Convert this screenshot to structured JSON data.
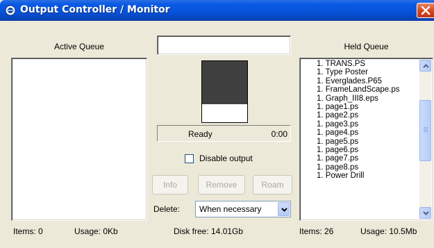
{
  "window": {
    "title": "Output Controller / Monitor"
  },
  "active_queue": {
    "header": "Active Queue",
    "items": [],
    "footer_items": "Items: 0",
    "footer_usage": "Usage: 0Kb"
  },
  "held_queue": {
    "header": "Held Queue",
    "items": [
      "1. TRANS.PS",
      "1. Type Poster",
      "1. Everglades.P65",
      "1. FrameLandScape.ps",
      "1. Graph_III8.eps",
      "1. page1.ps",
      "1. page2.ps",
      "1. page3.ps",
      "1. page4.ps",
      "1. page5.ps",
      "1. page6.ps",
      "1. page7.ps",
      "1. page8.ps",
      "1. Power Drill"
    ],
    "footer_items": "Items:  26",
    "footer_usage": "Usage: 10.5Mb"
  },
  "center": {
    "status_field_value": "",
    "status_text": "Ready",
    "status_time": "0:00",
    "disable_output_label": "Disable output",
    "disable_output_checked": false,
    "buttons": {
      "info": "Info",
      "remove": "Remove",
      "roam": "Roam"
    },
    "delete_label": "Delete:",
    "delete_selected": "When necessary",
    "disk_free": "Disk free:  14.01Gb"
  },
  "colors": {
    "titlebar": "#0654DA",
    "close_button": "#D5491E",
    "window_bg": "#ECE9D8",
    "preview_dark": "#404040"
  },
  "icons": {
    "app": "monitor-app-icon",
    "close": "close-icon",
    "scroll_up": "chevron-up-icon",
    "scroll_down": "chevron-down-icon",
    "dropdown": "chevron-down-icon"
  }
}
